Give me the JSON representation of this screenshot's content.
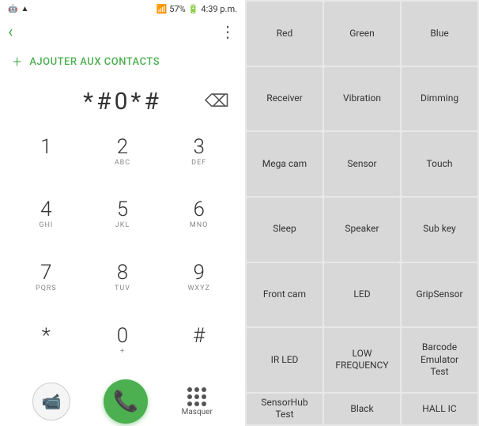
{
  "statusBar": {
    "leftIcons": "📶",
    "time": "4:39 p.m.",
    "batteryPercent": "57%",
    "signalIcon": "📡"
  },
  "topBar": {
    "backLabel": "‹",
    "moreLabel": "⋮"
  },
  "addContact": {
    "plus": "+",
    "label": "AJOUTER AUX CONTACTS"
  },
  "dialDisplay": {
    "number": "*#0*#",
    "backspace": "⌫"
  },
  "keypad": [
    {
      "digit": "1",
      "letters": ""
    },
    {
      "digit": "2",
      "letters": "ABC"
    },
    {
      "digit": "3",
      "letters": "DEF"
    },
    {
      "digit": "4",
      "letters": "GHI"
    },
    {
      "digit": "5",
      "letters": "JKL"
    },
    {
      "digit": "6",
      "letters": "MNO"
    },
    {
      "digit": "7",
      "letters": "PQRS"
    },
    {
      "digit": "8",
      "letters": "TUV"
    },
    {
      "digit": "9",
      "letters": "WXYZ"
    },
    {
      "digit": "*",
      "letters": ""
    },
    {
      "digit": "0",
      "letters": "+"
    },
    {
      "digit": "#",
      "letters": ""
    }
  ],
  "bottomBar": {
    "masquerLabel": "Masquer"
  },
  "testButtons": [
    {
      "label": "Red"
    },
    {
      "label": "Green"
    },
    {
      "label": "Blue"
    },
    {
      "label": "Receiver"
    },
    {
      "label": "Vibration"
    },
    {
      "label": "Dimming"
    },
    {
      "label": "Mega cam"
    },
    {
      "label": "Sensor"
    },
    {
      "label": "Touch"
    },
    {
      "label": "Sleep"
    },
    {
      "label": "Speaker"
    },
    {
      "label": "Sub key"
    },
    {
      "label": "Front cam"
    },
    {
      "label": "LED"
    },
    {
      "label": "GripSensor"
    },
    {
      "label": "IR LED"
    },
    {
      "label": "LOW\nFREQUENCY"
    },
    {
      "label": "Barcode\nEmulator\nTest"
    },
    {
      "label": "SensorHub\nTest"
    },
    {
      "label": "Black"
    },
    {
      "label": "HALL IC"
    }
  ]
}
